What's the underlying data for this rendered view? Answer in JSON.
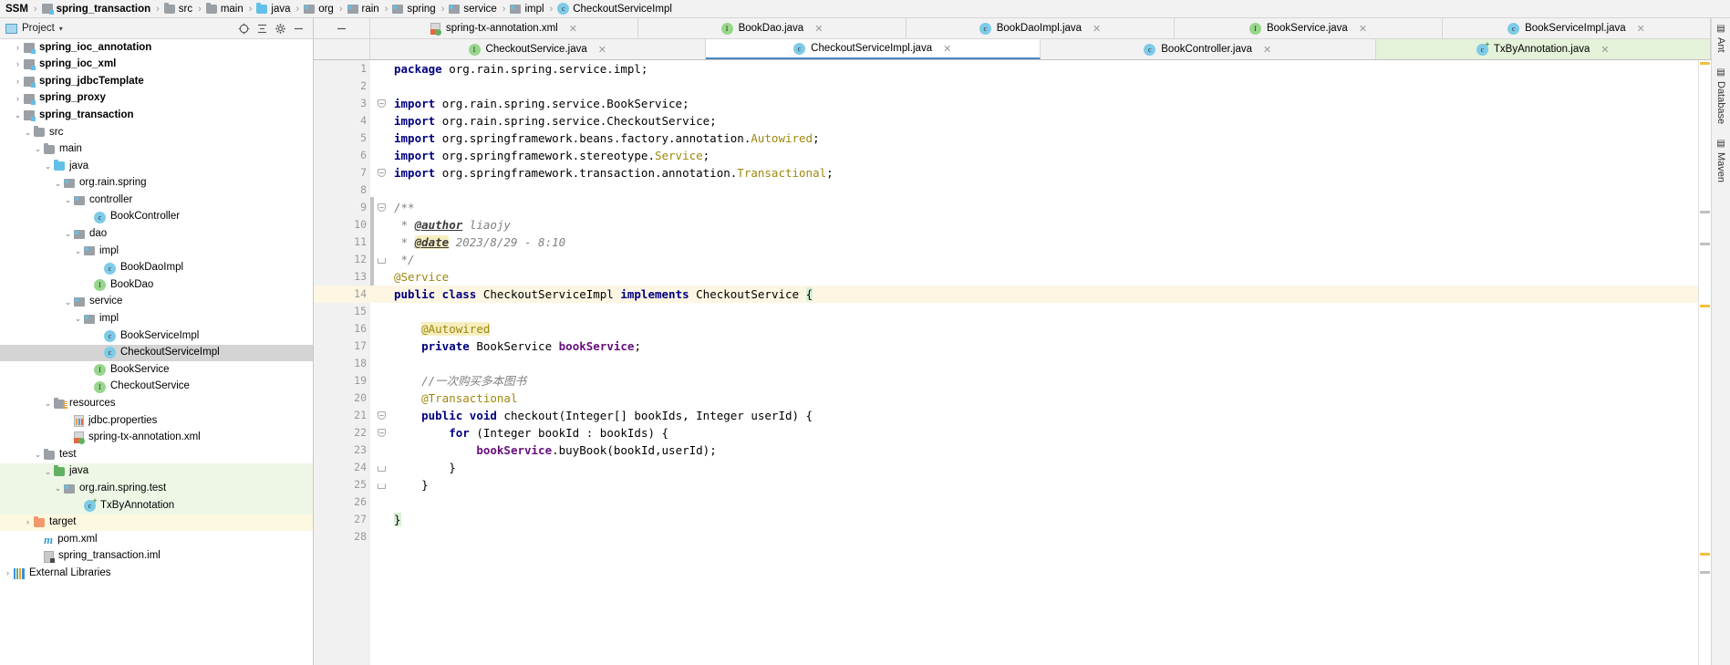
{
  "breadcrumb": {
    "items": [
      {
        "label": "SSM",
        "icon": "none",
        "bold": true
      },
      {
        "label": "spring_transaction",
        "icon": "module-icon",
        "bold": true
      },
      {
        "label": "src",
        "icon": "folder-icon",
        "bold": false
      },
      {
        "label": "main",
        "icon": "folder-icon",
        "bold": false
      },
      {
        "label": "java",
        "icon": "folder-blue-icon",
        "bold": false
      },
      {
        "label": "org",
        "icon": "package-icon",
        "bold": false
      },
      {
        "label": "rain",
        "icon": "package-icon",
        "bold": false
      },
      {
        "label": "spring",
        "icon": "package-icon",
        "bold": false
      },
      {
        "label": "service",
        "icon": "package-icon",
        "bold": false
      },
      {
        "label": "impl",
        "icon": "package-icon",
        "bold": false
      },
      {
        "label": "CheckoutServiceImpl",
        "icon": "class-icon",
        "bold": false
      }
    ],
    "separator": "›"
  },
  "project_panel": {
    "title": "Project",
    "caret": "▾",
    "buttons": [
      {
        "name": "locate-target-button",
        "glyph": "target-icon"
      },
      {
        "name": "collapse-all-button",
        "glyph": "collapse-icon"
      },
      {
        "name": "settings-button",
        "glyph": "gear-icon"
      },
      {
        "name": "hide-button",
        "glyph": "minus-icon"
      }
    ],
    "tree": [
      {
        "label": "spring_ioc_annotation",
        "indent": 1,
        "arrow": "›",
        "icon": "module-icon",
        "bold": true,
        "state": "normal"
      },
      {
        "label": "spring_ioc_xml",
        "indent": 1,
        "arrow": "›",
        "icon": "module-icon",
        "bold": true,
        "state": "normal"
      },
      {
        "label": "spring_jdbcTemplate",
        "indent": 1,
        "arrow": "›",
        "icon": "module-icon",
        "bold": true,
        "state": "normal"
      },
      {
        "label": "spring_proxy",
        "indent": 1,
        "arrow": "›",
        "icon": "module-icon",
        "bold": true,
        "state": "normal"
      },
      {
        "label": "spring_transaction",
        "indent": 1,
        "arrow": "⌄",
        "icon": "module-icon",
        "bold": true,
        "state": "normal"
      },
      {
        "label": "src",
        "indent": 2,
        "arrow": "⌄",
        "icon": "folder-icon",
        "bold": false,
        "state": "normal"
      },
      {
        "label": "main",
        "indent": 3,
        "arrow": "⌄",
        "icon": "folder-icon",
        "bold": false,
        "state": "normal"
      },
      {
        "label": "java",
        "indent": 4,
        "arrow": "⌄",
        "icon": "folder-blue-icon",
        "bold": false,
        "state": "normal"
      },
      {
        "label": "org.rain.spring",
        "indent": 5,
        "arrow": "⌄",
        "icon": "package-icon",
        "bold": false,
        "state": "normal"
      },
      {
        "label": "controller",
        "indent": 6,
        "arrow": "⌄",
        "icon": "package-icon",
        "bold": false,
        "state": "normal"
      },
      {
        "label": "BookController",
        "indent": 8,
        "arrow": "",
        "icon": "class-icon",
        "bold": false,
        "state": "normal"
      },
      {
        "label": "dao",
        "indent": 6,
        "arrow": "⌄",
        "icon": "package-icon",
        "bold": false,
        "state": "normal"
      },
      {
        "label": "impl",
        "indent": 7,
        "arrow": "⌄",
        "icon": "package-icon",
        "bold": false,
        "state": "normal"
      },
      {
        "label": "BookDaoImpl",
        "indent": 9,
        "arrow": "",
        "icon": "class-icon",
        "bold": false,
        "state": "normal"
      },
      {
        "label": "BookDao",
        "indent": 8,
        "arrow": "",
        "icon": "interface-icon",
        "bold": false,
        "state": "normal"
      },
      {
        "label": "service",
        "indent": 6,
        "arrow": "⌄",
        "icon": "package-icon",
        "bold": false,
        "state": "normal"
      },
      {
        "label": "impl",
        "indent": 7,
        "arrow": "⌄",
        "icon": "package-icon",
        "bold": false,
        "state": "normal"
      },
      {
        "label": "BookServiceImpl",
        "indent": 9,
        "arrow": "",
        "icon": "class-icon",
        "bold": false,
        "state": "normal"
      },
      {
        "label": "CheckoutServiceImpl",
        "indent": 9,
        "arrow": "",
        "icon": "class-icon",
        "bold": false,
        "state": "selected"
      },
      {
        "label": "BookService",
        "indent": 8,
        "arrow": "",
        "icon": "interface-icon",
        "bold": false,
        "state": "normal"
      },
      {
        "label": "CheckoutService",
        "indent": 8,
        "arrow": "",
        "icon": "interface-icon",
        "bold": false,
        "state": "normal"
      },
      {
        "label": "resources",
        "indent": 4,
        "arrow": "⌄",
        "icon": "resources-folder-icon",
        "bold": false,
        "state": "normal"
      },
      {
        "label": "jdbc.properties",
        "indent": 6,
        "arrow": "",
        "icon": "properties-icon",
        "bold": false,
        "state": "normal"
      },
      {
        "label": "spring-tx-annotation.xml",
        "indent": 6,
        "arrow": "",
        "icon": "xml-icon",
        "bold": false,
        "state": "normal"
      },
      {
        "label": "test",
        "indent": 3,
        "arrow": "⌄",
        "icon": "folder-icon",
        "bold": false,
        "state": "normal"
      },
      {
        "label": "java",
        "indent": 4,
        "arrow": "⌄",
        "icon": "folder-green-icon",
        "bold": false,
        "state": "green"
      },
      {
        "label": "org.rain.spring.test",
        "indent": 5,
        "arrow": "⌄",
        "icon": "package-icon",
        "bold": false,
        "state": "green"
      },
      {
        "label": "TxByAnnotation",
        "indent": 7,
        "arrow": "",
        "icon": "test-class-icon",
        "bold": false,
        "state": "green"
      },
      {
        "label": "target",
        "indent": 2,
        "arrow": "›",
        "icon": "folder-orange-icon",
        "bold": false,
        "state": "yellow"
      },
      {
        "label": "pom.xml",
        "indent": 3,
        "arrow": "",
        "icon": "maven-icon",
        "bold": false,
        "state": "normal"
      },
      {
        "label": "spring_transaction.iml",
        "indent": 3,
        "arrow": "",
        "icon": "iml-icon",
        "bold": false,
        "state": "normal"
      },
      {
        "label": "External Libraries",
        "indent": 0,
        "arrow": "›",
        "icon": "libraries-icon",
        "bold": false,
        "state": "normal"
      }
    ]
  },
  "editor_tabs": {
    "row1": [
      {
        "label": "spring-tx-annotation.xml",
        "icon": "xml-icon",
        "state": "inactive",
        "close": "✕"
      },
      {
        "label": "BookDao.java",
        "icon": "interface-icon",
        "state": "inactive",
        "close": "✕"
      },
      {
        "label": "BookDaoImpl.java",
        "icon": "class-icon",
        "state": "inactive",
        "close": "✕"
      },
      {
        "label": "BookService.java",
        "icon": "interface-icon",
        "state": "inactive",
        "close": "✕"
      },
      {
        "label": "BookServiceImpl.java",
        "icon": "class-icon",
        "state": "inactive",
        "close": "✕"
      }
    ],
    "row2": [
      {
        "label": "CheckoutService.java",
        "icon": "interface-icon",
        "state": "inactive",
        "close": "✕"
      },
      {
        "label": "CheckoutServiceImpl.java",
        "icon": "class-icon",
        "state": "active",
        "close": "✕"
      },
      {
        "label": "BookController.java",
        "icon": "class-icon",
        "state": "inactive",
        "close": "✕"
      },
      {
        "label": "TxByAnnotation.java",
        "icon": "test-class-icon",
        "state": "green",
        "close": "✕"
      }
    ]
  },
  "code": {
    "filename": "CheckoutServiceImpl.java",
    "lines": [
      {
        "n": 1,
        "fold": "",
        "tokens": [
          {
            "t": "package ",
            "c": "kw"
          },
          {
            "t": "org.rain.spring.service.impl;",
            "c": "plain"
          }
        ]
      },
      {
        "n": 2,
        "fold": "",
        "tokens": []
      },
      {
        "n": 3,
        "fold": "minus",
        "tokens": [
          {
            "t": "import ",
            "c": "kw"
          },
          {
            "t": "org.rain.spring.service.BookService;",
            "c": "plain"
          }
        ]
      },
      {
        "n": 4,
        "fold": "",
        "tokens": [
          {
            "t": "import ",
            "c": "kw"
          },
          {
            "t": "org.rain.spring.service.CheckoutService;",
            "c": "plain"
          }
        ]
      },
      {
        "n": 5,
        "fold": "",
        "tokens": [
          {
            "t": "import ",
            "c": "kw"
          },
          {
            "t": "org.springframework.beans.factory.annotation.",
            "c": "plain"
          },
          {
            "t": "Autowired",
            "c": "anno"
          },
          {
            "t": ";",
            "c": "plain"
          }
        ]
      },
      {
        "n": 6,
        "fold": "",
        "tokens": [
          {
            "t": "import ",
            "c": "kw"
          },
          {
            "t": "org.springframework.stereotype.",
            "c": "plain"
          },
          {
            "t": "Service",
            "c": "anno"
          },
          {
            "t": ";",
            "c": "plain"
          }
        ]
      },
      {
        "n": 7,
        "fold": "minus",
        "tokens": [
          {
            "t": "import ",
            "c": "kw"
          },
          {
            "t": "org.springframework.transaction.annotation.",
            "c": "plain"
          },
          {
            "t": "Transactional",
            "c": "anno"
          },
          {
            "t": ";",
            "c": "plain"
          }
        ]
      },
      {
        "n": 8,
        "fold": "",
        "tokens": []
      },
      {
        "n": 9,
        "fold": "minus",
        "tokens": [
          {
            "t": "/**",
            "c": "cmt"
          }
        ]
      },
      {
        "n": 10,
        "fold": "",
        "tokens": [
          {
            "t": " * ",
            "c": "cmt"
          },
          {
            "t": "@author",
            "c": "cmt-tag"
          },
          {
            "t": " liaojy",
            "c": "cmt"
          }
        ]
      },
      {
        "n": 11,
        "fold": "",
        "tokens": [
          {
            "t": " * ",
            "c": "cmt"
          },
          {
            "t": "@date",
            "c": "cmt-tag-hl"
          },
          {
            "t": " 2023/8/29 - 8:10",
            "c": "cmt"
          }
        ]
      },
      {
        "n": 12,
        "fold": "end",
        "tokens": [
          {
            "t": " */",
            "c": "cmt"
          }
        ]
      },
      {
        "n": 13,
        "fold": "",
        "tokens": [
          {
            "t": "@Service",
            "c": "anno"
          }
        ]
      },
      {
        "n": 14,
        "fold": "",
        "hl": true,
        "tokens": [
          {
            "t": "public class ",
            "c": "kw"
          },
          {
            "t": "CheckoutServiceImpl ",
            "c": "plain"
          },
          {
            "t": "implements ",
            "c": "kw"
          },
          {
            "t": "CheckoutService ",
            "c": "plain"
          },
          {
            "t": "{",
            "c": "brace-hl"
          }
        ]
      },
      {
        "n": 15,
        "fold": "",
        "tokens": []
      },
      {
        "n": 16,
        "fold": "",
        "tokens": [
          {
            "t": "    ",
            "c": "plain"
          },
          {
            "t": "@Autowired",
            "c": "anno-hl"
          }
        ]
      },
      {
        "n": 17,
        "fold": "",
        "tokens": [
          {
            "t": "    ",
            "c": "plain"
          },
          {
            "t": "private ",
            "c": "kw"
          },
          {
            "t": "BookService ",
            "c": "plain"
          },
          {
            "t": "bookService",
            "c": "fld"
          },
          {
            "t": ";",
            "c": "plain"
          }
        ]
      },
      {
        "n": 18,
        "fold": "",
        "tokens": []
      },
      {
        "n": 19,
        "fold": "",
        "tokens": [
          {
            "t": "    ",
            "c": "plain"
          },
          {
            "t": "//一次购买多本图书",
            "c": "cmt"
          }
        ]
      },
      {
        "n": 20,
        "fold": "",
        "tokens": [
          {
            "t": "    ",
            "c": "plain"
          },
          {
            "t": "@Transactional",
            "c": "anno"
          }
        ]
      },
      {
        "n": 21,
        "fold": "minus",
        "marks": "bean-gutter-icon",
        "tokens": [
          {
            "t": "    ",
            "c": "plain"
          },
          {
            "t": "public void ",
            "c": "kw"
          },
          {
            "t": "checkout(Integer[] bookIds, Integer userId) {",
            "c": "plain"
          }
        ]
      },
      {
        "n": 22,
        "fold": "minus",
        "tokens": [
          {
            "t": "        ",
            "c": "plain"
          },
          {
            "t": "for ",
            "c": "kw"
          },
          {
            "t": "(Integer bookId : bookIds) {",
            "c": "plain"
          }
        ]
      },
      {
        "n": 23,
        "fold": "",
        "tokens": [
          {
            "t": "            ",
            "c": "plain"
          },
          {
            "t": "bookService",
            "c": "fld"
          },
          {
            "t": ".buyBook(bookId,userId);",
            "c": "plain"
          }
        ]
      },
      {
        "n": 24,
        "fold": "end",
        "tokens": [
          {
            "t": "        }",
            "c": "plain"
          }
        ]
      },
      {
        "n": 25,
        "fold": "end",
        "tokens": [
          {
            "t": "    }",
            "c": "plain"
          }
        ]
      },
      {
        "n": 26,
        "fold": "",
        "tokens": []
      },
      {
        "n": 27,
        "fold": "",
        "tokens": [
          {
            "t": "}",
            "c": "brace-hl"
          }
        ]
      },
      {
        "n": 28,
        "fold": "",
        "tokens": []
      }
    ],
    "gutter_icon_line21": "●↑ @"
  },
  "right_toolwindows": [
    {
      "label": "Ant",
      "name": "tool-window-ant"
    },
    {
      "label": "Database",
      "name": "tool-window-database"
    },
    {
      "label": "Maven",
      "name": "tool-window-maven"
    }
  ],
  "colors": {
    "selection_gray": "#d4d4d4",
    "test_green_bg": "#eef7e6",
    "target_yellow_bg": "#fdf8e0",
    "caret_line": "#fdf6e3",
    "accent_blue": "#4a88c7",
    "annotation_yellow": "#9e880d",
    "keyword_navy": "#000080",
    "field_purple": "#660e7a",
    "comment_gray": "#808080"
  }
}
